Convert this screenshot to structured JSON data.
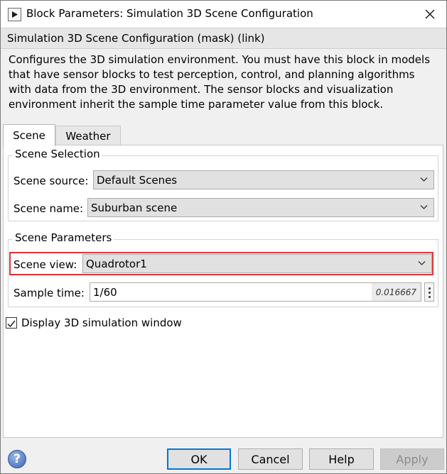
{
  "window": {
    "title": "Block Parameters: Simulation 3D Scene Configuration"
  },
  "mask": {
    "heading": "Simulation 3D Scene Configuration (mask) (link)"
  },
  "description": "Configures the 3D simulation environment. You must have this block in models that have sensor blocks to test perception, control, and planning algorithms with data from the 3D environment. The sensor blocks and visualization environment inherit the sample time parameter value from this block.",
  "tabs": [
    {
      "label": "Scene",
      "active": true
    },
    {
      "label": "Weather",
      "active": false
    }
  ],
  "scene_selection": {
    "title": "Scene Selection",
    "source_label": "Scene source:",
    "source_value": "Default Scenes",
    "name_label": "Scene name:",
    "name_value": "Suburban scene"
  },
  "scene_parameters": {
    "title": "Scene Parameters",
    "view_label": "Scene view:",
    "view_value": "Quadrotor1",
    "sample_label": "Sample time:",
    "sample_value": "1/60",
    "sample_evaluated": "0.016667"
  },
  "display_window": {
    "label": "Display 3D simulation window",
    "checked": true
  },
  "buttons": {
    "ok": "OK",
    "cancel": "Cancel",
    "help": "Help",
    "apply": "Apply",
    "help_icon": "?"
  },
  "icons": {
    "app": "simulink-block-icon",
    "close": "close-icon",
    "chevron": "chevron-down-icon",
    "more": "more-vertical-icon",
    "help": "help-circle-icon"
  },
  "colors": {
    "highlight": "#d9363e",
    "default_button_border": "#0078d7"
  }
}
